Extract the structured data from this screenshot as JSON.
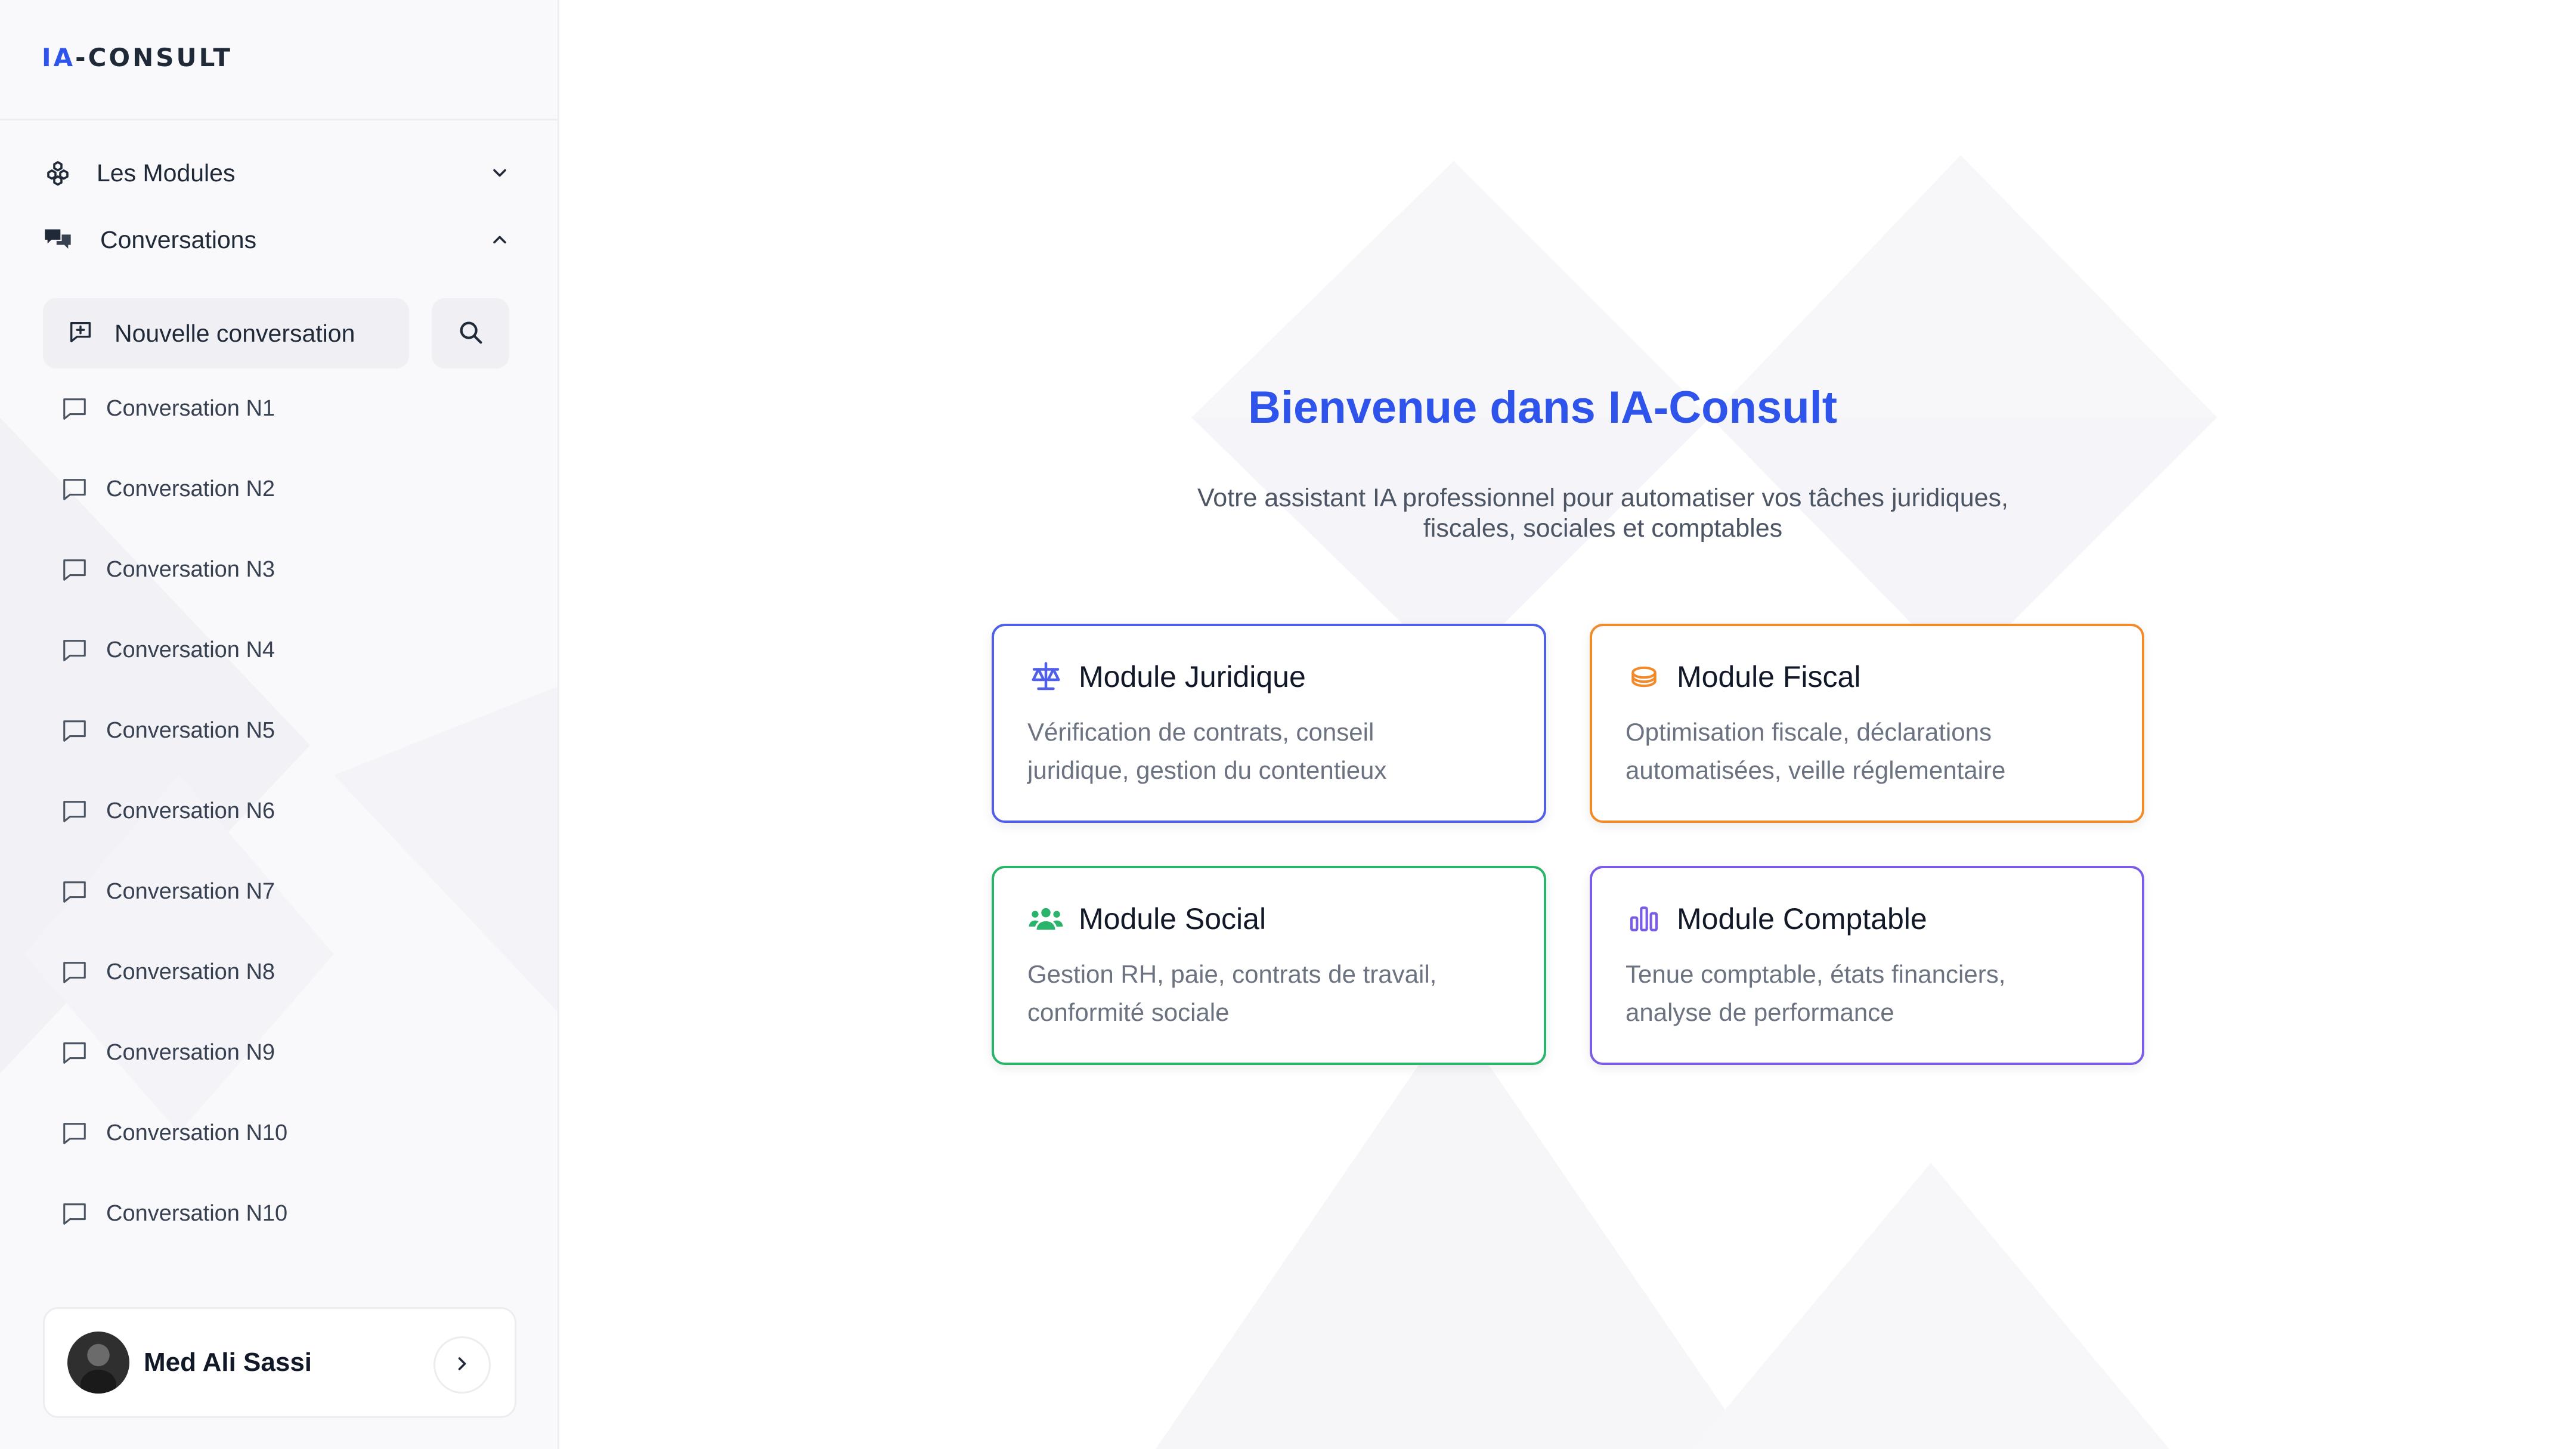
{
  "app": {
    "logo_prefix": "IA",
    "logo_rest": "-CONSULT"
  },
  "sidebar": {
    "modules_label": "Les Modules",
    "conversations_label": "Conversations",
    "new_conversation_label": "Nouvelle conversation",
    "conversations": [
      "Conversation N1",
      "Conversation N2",
      "Conversation N3",
      "Conversation N4",
      "Conversation N5",
      "Conversation N6",
      "Conversation N7",
      "Conversation N8",
      "Conversation N9",
      "Conversation N10",
      "Conversation N10"
    ],
    "user_name": "Med Ali Sassi"
  },
  "main": {
    "title": "Bienvenue dans IA-Consult",
    "subtitle_line1": "Votre assistant IA professionnel pour automatiser vos tâches juridiques,",
    "subtitle_line2": "fiscales, sociales et comptables",
    "modules": [
      {
        "title": "Module Juridique",
        "description": "Vérification de contrats, conseil juridique, gestion du contentieux",
        "icon": "scale-icon",
        "color": "#4f5fe8"
      },
      {
        "title": "Module Fiscal",
        "description": "Optimisation fiscale, déclarations automatisées, veille réglementaire",
        "icon": "coins-icon",
        "color": "#f28a2a"
      },
      {
        "title": "Module Social",
        "description": "Gestion RH, paie, contrats de travail, conformité sociale",
        "icon": "users-icon",
        "color": "#29b36b"
      },
      {
        "title": "Module Comptable",
        "description": "Tenue comptable, états financiers, analyse de performance",
        "icon": "bar-chart-icon",
        "color": "#7a5ce6"
      }
    ]
  },
  "colors": {
    "accent": "#2f54eb",
    "sidebar_bg": "#f9f9fb"
  }
}
